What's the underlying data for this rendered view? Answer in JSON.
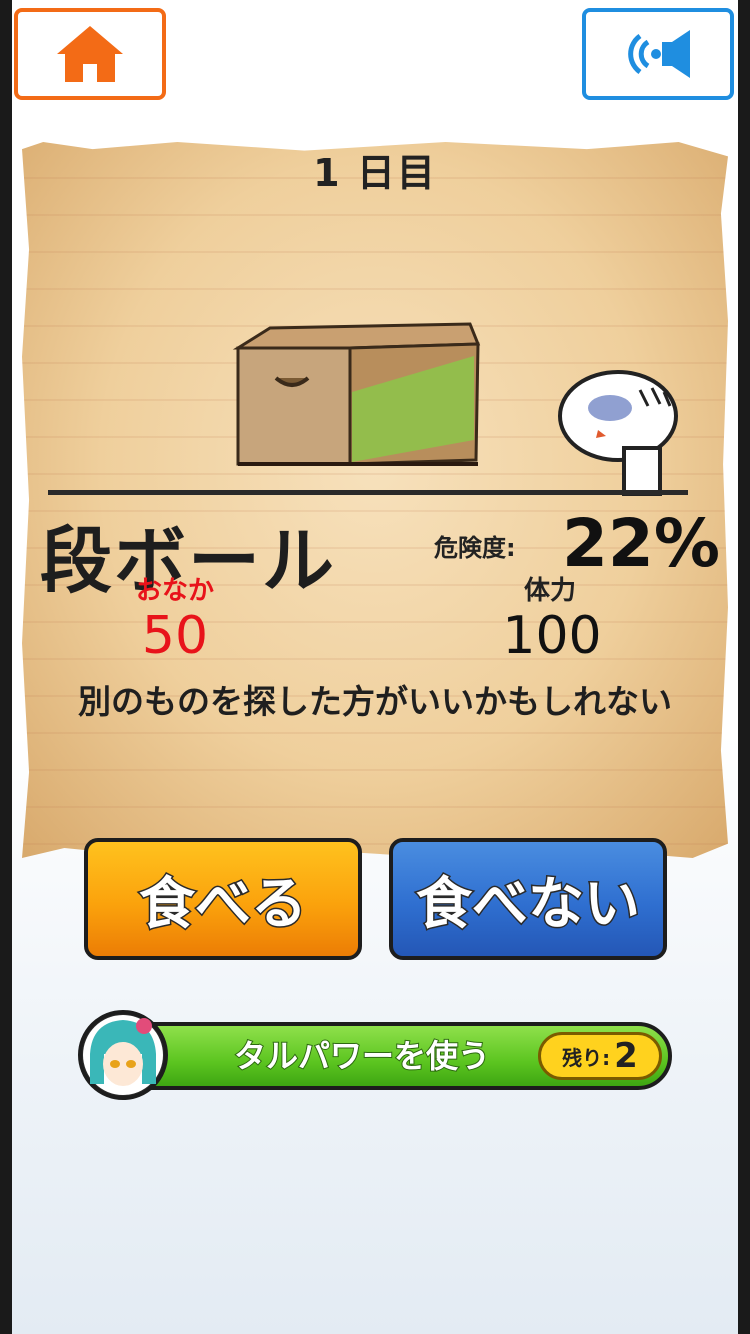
{
  "header": {
    "home_icon": "home-icon",
    "sound_icon": "speaker-icon"
  },
  "game": {
    "day_label": "1 日目",
    "item_name": "段ボール",
    "danger_label": "危険度:",
    "danger_value": "22%",
    "hunger_label": "おなか",
    "hunger_value": "50",
    "stamina_label": "体力",
    "stamina_value": "100",
    "message": "別のものを探した方がいいかもしれない"
  },
  "actions": {
    "eat_label": "食べる",
    "dont_eat_label": "食べない"
  },
  "power": {
    "label": "タルパワーを使う",
    "remaining_label": "残り:",
    "remaining_value": "2"
  },
  "colors": {
    "home_accent": "#f36b16",
    "sound_accent": "#1f8ee0",
    "hunger_red": "#e8131a",
    "eat_orange": "#fba20c",
    "dont_eat_blue": "#2f6fd0",
    "power_green": "#5cc520"
  }
}
